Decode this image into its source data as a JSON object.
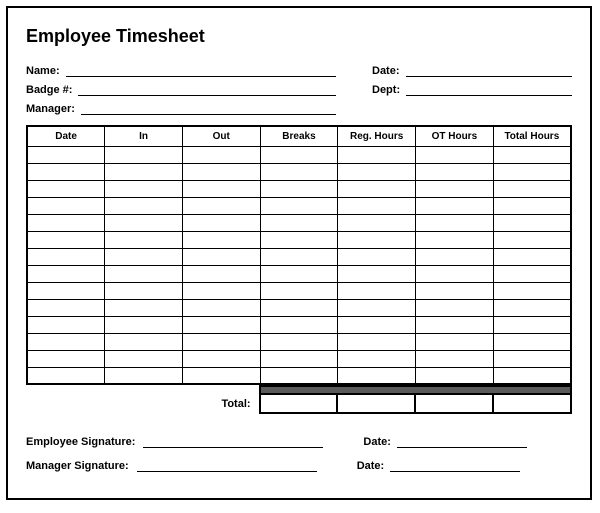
{
  "title": "Employee Timesheet",
  "meta": {
    "name_label": "Name:",
    "badge_label": "Badge #:",
    "manager_label": "Manager:",
    "date_label": "Date:",
    "dept_label": "Dept:"
  },
  "columns": {
    "date": "Date",
    "in": "In",
    "out": "Out",
    "breaks": "Breaks",
    "reg": "Reg. Hours",
    "ot": "OT Hours",
    "total": "Total Hours"
  },
  "row_count": 14,
  "total_label": "Total:",
  "signatures": {
    "employee": "Employee Signature:",
    "manager": "Manager Signature:",
    "date": "Date:"
  }
}
